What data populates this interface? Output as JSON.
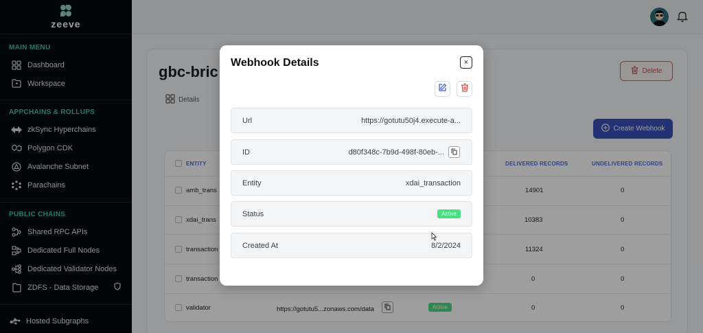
{
  "brand": {
    "name": "zeeve"
  },
  "sidebar": {
    "main_menu_title": "MAIN MENU",
    "main_items": [
      {
        "label": "Dashboard",
        "icon": "grid-icon"
      },
      {
        "label": "Workspace",
        "icon": "folder-icon"
      }
    ],
    "appchains_title": "APPCHAINS & ROLLUPS",
    "appchain_items": [
      {
        "label": "zkSync Hyperchains",
        "icon": "zksync-icon"
      },
      {
        "label": "Polygon CDK",
        "icon": "polygon-icon"
      },
      {
        "label": "Avalanche Subnet",
        "icon": "avalanche-icon"
      },
      {
        "label": "Parachains",
        "icon": "parachain-icon"
      }
    ],
    "public_title": "PUBLIC CHAINS",
    "public_items": [
      {
        "label": "Shared RPC APIs",
        "icon": "rpc-icon"
      },
      {
        "label": "Dedicated Full Nodes",
        "icon": "full-node-icon"
      },
      {
        "label": "Dedicated Validator Nodes",
        "icon": "validator-node-icon"
      },
      {
        "label": "ZDFS - Data Storage",
        "icon": "storage-icon"
      }
    ],
    "bottom_items": [
      {
        "label": "Hosted Subgraphs",
        "icon": "subgraph-icon"
      }
    ]
  },
  "page": {
    "title": "gbc-bric",
    "tab_details": "Details",
    "delete_label": "Delete",
    "create_webhook_label": "Create Webhook"
  },
  "table": {
    "headers": {
      "entity": "ENTITY",
      "delivered": "DELIVERED RECORDS",
      "undelivered": "UNDELIVERED RECORDS"
    },
    "rows": [
      {
        "entity": "amb_trans",
        "url": "",
        "status": "",
        "delivered": "14901",
        "undelivered": "0"
      },
      {
        "entity": "xdai_trans",
        "url": "",
        "status": "",
        "delivered": "10383",
        "undelivered": "0"
      },
      {
        "entity": "transaction",
        "url": "",
        "status": "",
        "delivered": "11324",
        "undelivered": "0"
      },
      {
        "entity": "transaction",
        "url": "",
        "status": "",
        "delivered": "0",
        "undelivered": "0"
      },
      {
        "entity": "validator",
        "url": "https://gotutu5...zonaws.com/data",
        "status": "Active",
        "delivered": "0",
        "undelivered": "0"
      }
    ]
  },
  "modal": {
    "title": "Webhook Details",
    "close_symbol": "×",
    "fields": [
      {
        "label": "Url",
        "value": "https://gotutu50j4.execute-a..."
      },
      {
        "label": "ID",
        "value": "d80f348c-7b9d-498f-80eb-..."
      },
      {
        "label": "Entity",
        "value": "xdai_transaction"
      },
      {
        "label": "Status",
        "value": "Active"
      },
      {
        "label": "Created At",
        "value": "8/2/2024"
      }
    ]
  },
  "colors": {
    "sidebar_bg": "#030b0d",
    "section_title": "#3fc3a9",
    "primary_button": "#3b4fb8",
    "delete": "#d9433a",
    "active_badge": "#4ade80",
    "table_header": "#4a6fd1"
  }
}
